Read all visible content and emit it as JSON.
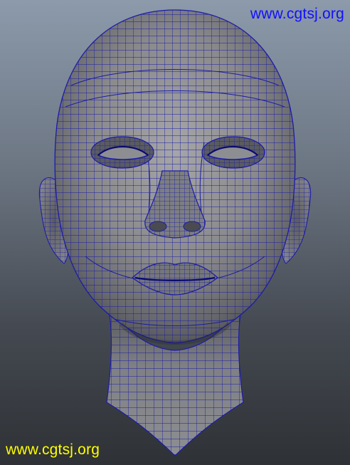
{
  "viewport": {
    "subject": "head-wireframe-mesh"
  },
  "watermarks": {
    "top": "www.cgtsj.org",
    "bottom": "www.cgtsj.org"
  },
  "colors": {
    "wireframe": "#1c1ca8",
    "surface_light": "#9a9a9c",
    "surface_shadow": "#3f4045",
    "watermark_top": "#1010ff",
    "watermark_bottom": "#ffff00"
  }
}
